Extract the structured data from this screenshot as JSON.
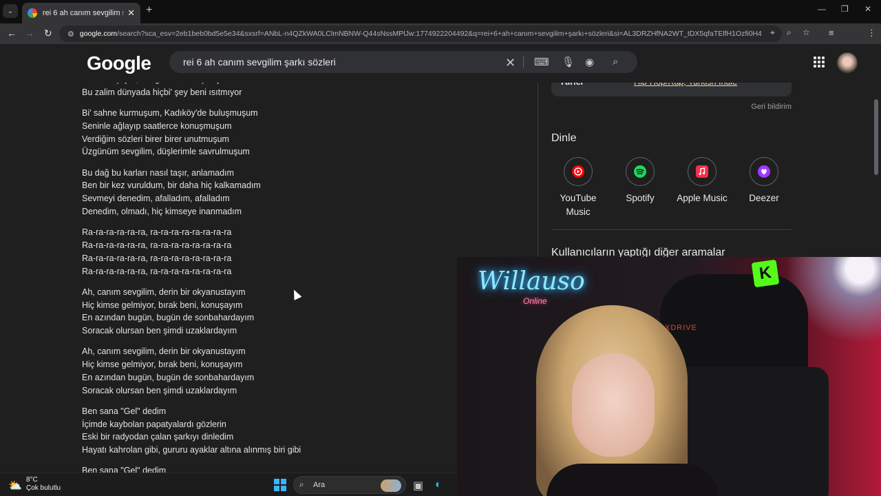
{
  "browser": {
    "tab_title": "rei 6 ah canım sevgilim şarkı sö",
    "tab_close": "✕",
    "new_tab": "+",
    "url_site": "google.com",
    "url_rest": "/search?sca_esv=2eb1beb0bd5e5e34&sxsrf=ANbL-n4QZkWA0LClmNBNW-Q44sNssMPlJw:1774922204492&q=rei+6+ah+canım+sevgilim+şarkı+sözleri&si=AL3DRZHfNA2WT_tDX5qfaTElfH1Ozfi0H4v..."
  },
  "search": {
    "query": "rei 6 ah canım sevgilim şarkı sözleri"
  },
  "lyrics": [
    [
      "Ellerim üşüyor, fotoğraflar konuşmuyor",
      "Bu zalim dünyada hiçbi' şey beni ısıtmıyor"
    ],
    [
      "Bi' sahne kurmuşum, Kadıköy'de buluşmuşum",
      "Seninle ağlayıp saatlerce konuşmuşum",
      "Verdiğim sözleri birer birer unutmuşum",
      "Üzgünüm sevgilim, düşlerimle savrulmuşum"
    ],
    [
      "Bu dağ bu karları nasıl taşır, anlamadım",
      "Ben bir kez vuruldum, bir daha hiç kalkamadım",
      "Sevmeyi denedim, afalladım, afalladım",
      "Denedim, olmadı, hiç kimseye inanmadım"
    ],
    [
      "Ra-ra-ra-ra-ra-ra, ra-ra-ra-ra-ra-ra-ra-ra",
      "Ra-ra-ra-ra-ra-ra, ra-ra-ra-ra-ra-ra-ra-ra",
      "Ra-ra-ra-ra-ra-ra, ra-ra-ra-ra-ra-ra-ra-ra",
      "Ra-ra-ra-ra-ra-ra, ra-ra-ra-ra-ra-ra-ra-ra"
    ],
    [
      "Ah, canım sevgilim, derin bir okyanustayım",
      "Hiç kimse gelmiyor, bırak beni, konuşayım",
      "En azından bugün, bugün de sonbahardayım",
      "Soracak olursan ben şimdi uzaklardayım"
    ],
    [
      "Ah, canım sevgilim, derin bir okyanustayım",
      "Hiç kimse gelmiyor, bırak beni, konuşayım",
      "En azından bugün, bugün de sonbahardayım",
      "Soracak olursan ben şimdi uzaklardayım"
    ],
    [
      "Ben sana \"Gel\" dedim",
      "İçimde kaybolan papatyalardı gözlerin",
      "Eski bir radyodan çalan şarkıyı dinledim",
      "Hayatı kahrolan gibi, gururu ayaklar altına alınmış biri gibi"
    ],
    [
      "Ben sana \"Gel\" dedim"
    ]
  ],
  "knowledge_panel": {
    "genre_key": "Türler",
    "genres": [
      "Hip-Hop/Rap",
      "Turkish Indie"
    ],
    "feedback": "Geri bildirim",
    "listen_heading": "Dinle",
    "services": [
      {
        "name": "YouTube Music",
        "label1": "YouTube",
        "label2": "Music",
        "color": "#ff0000"
      },
      {
        "name": "Spotify",
        "label1": "Spotify",
        "label2": "",
        "color": "#1ed760"
      },
      {
        "name": "Apple Music",
        "label1": "Apple Music",
        "label2": "",
        "color": "#fa2d48"
      },
      {
        "name": "Deezer",
        "label1": "Deezer",
        "label2": "",
        "color": "#a238ff"
      }
    ],
    "others_heading": "Kullanıcıların yaptığı diğer aramalar"
  },
  "webcam": {
    "neon_text": "Willauso",
    "neon_sub": "Online",
    "chair_brand": "XDRIVE",
    "badge": "K"
  },
  "taskbar": {
    "temperature": "8°C",
    "weather": "Çok bulutlu",
    "search_label": "Ara"
  }
}
